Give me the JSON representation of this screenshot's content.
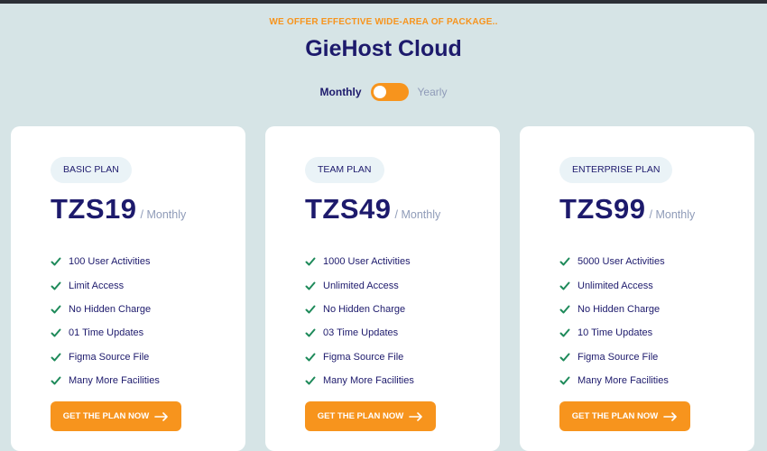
{
  "header": {
    "eyebrow": "WE OFFER EFFECTIVE WIDE-AREA OF PACKAGE..",
    "title": "GieHost Cloud"
  },
  "billing_toggle": {
    "monthly_label": "Monthly",
    "yearly_label": "Yearly",
    "selected": "Monthly"
  },
  "colors": {
    "accent": "#f7941d",
    "heading": "#1d1a6c",
    "muted": "#8f9bb8",
    "check": "#1e8a5a",
    "background": "#d6e4e6"
  },
  "plans": [
    {
      "name": "BASIC PLAN",
      "price": "TZS19",
      "period": "/ Monthly",
      "features": [
        "100 User Activities",
        "Limit Access",
        "No Hidden Charge",
        "01 Time Updates",
        "Figma Source File",
        "Many More Facilities"
      ],
      "cta": "GET THE PLAN NOW"
    },
    {
      "name": "TEAM PLAN",
      "price": "TZS49",
      "period": "/ Monthly",
      "features": [
        "1000 User Activities",
        "Unlimited Access",
        "No Hidden Charge",
        "03 Time Updates",
        "Figma Source File",
        "Many More Facilities"
      ],
      "cta": "GET THE PLAN NOW"
    },
    {
      "name": "ENTERPRISE PLAN",
      "price": "TZS99",
      "period": "/ Monthly",
      "features": [
        "5000 User Activities",
        "Unlimited Access",
        "No Hidden Charge",
        "10 Time Updates",
        "Figma Source File",
        "Many More Facilities"
      ],
      "cta": "GET THE PLAN NOW"
    }
  ]
}
